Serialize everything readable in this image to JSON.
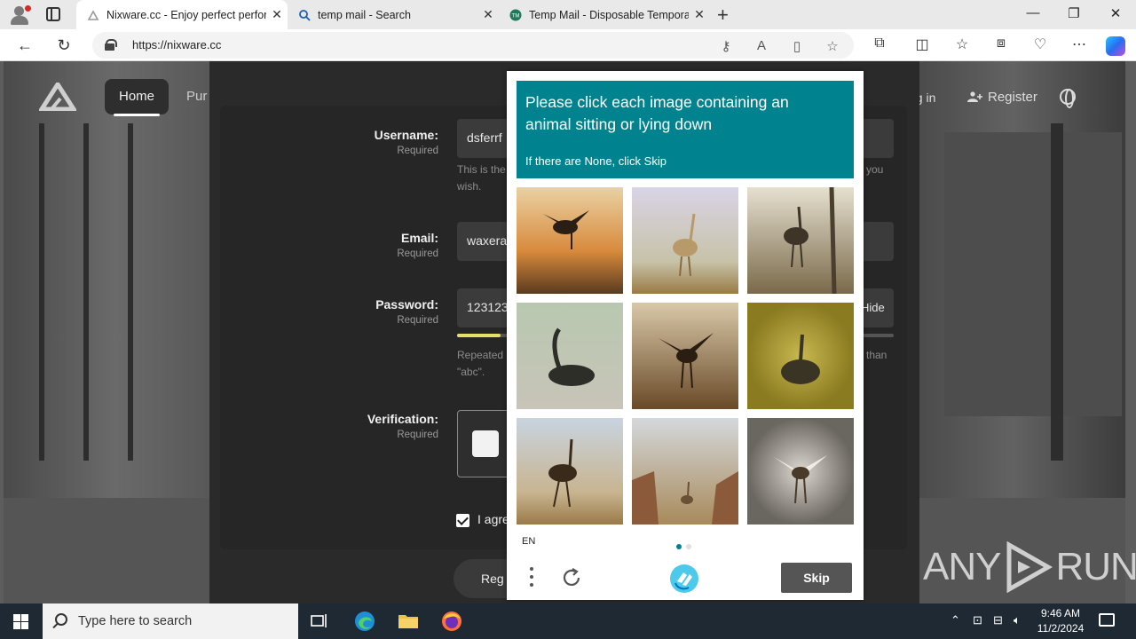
{
  "browser": {
    "tabs": [
      {
        "title": "Nixware.cc - Enjoy perfect perfor",
        "active": true
      },
      {
        "title": "temp mail - Search",
        "active": false
      },
      {
        "title": "Temp Mail - Disposable Tempora",
        "active": false
      }
    ],
    "url": "https://nixware.cc",
    "window_controls": {
      "minimize": "—",
      "maximize": "❐",
      "close": "✕"
    }
  },
  "site": {
    "nav": {
      "home": "Home",
      "purchase": "Pur",
      "login": "og in",
      "register": "Register"
    },
    "form": {
      "username": {
        "label": "Username:",
        "required": "Required",
        "value": "dsferrf",
        "help_left": "This is the",
        "help_right": "you",
        "help_wrap": "wish."
      },
      "email": {
        "label": "Email:",
        "required": "Required",
        "value": "waxera"
      },
      "password": {
        "label": "Password:",
        "required": "Required",
        "value": "123123",
        "hide": "Hide",
        "strength_percent": 10,
        "help_left": "Repeated",
        "help_right": "than",
        "help_wrap": "\"abc\"."
      },
      "verification": {
        "label": "Verification:",
        "required": "Required"
      },
      "agree": "I agre",
      "register_button": "Reg"
    },
    "watermark": {
      "left": "ANY",
      "right": "RUN"
    }
  },
  "captcha": {
    "prompt": "Please click each image containing an animal sitting or lying down",
    "sub": "If there are None, click Skip",
    "language": "EN",
    "skip": "Skip",
    "accent": "#00838f",
    "page_dots": [
      true,
      false
    ]
  },
  "taskbar": {
    "search_placeholder": "Type here to search",
    "time": "9:46 AM",
    "date": "11/2/2024"
  }
}
